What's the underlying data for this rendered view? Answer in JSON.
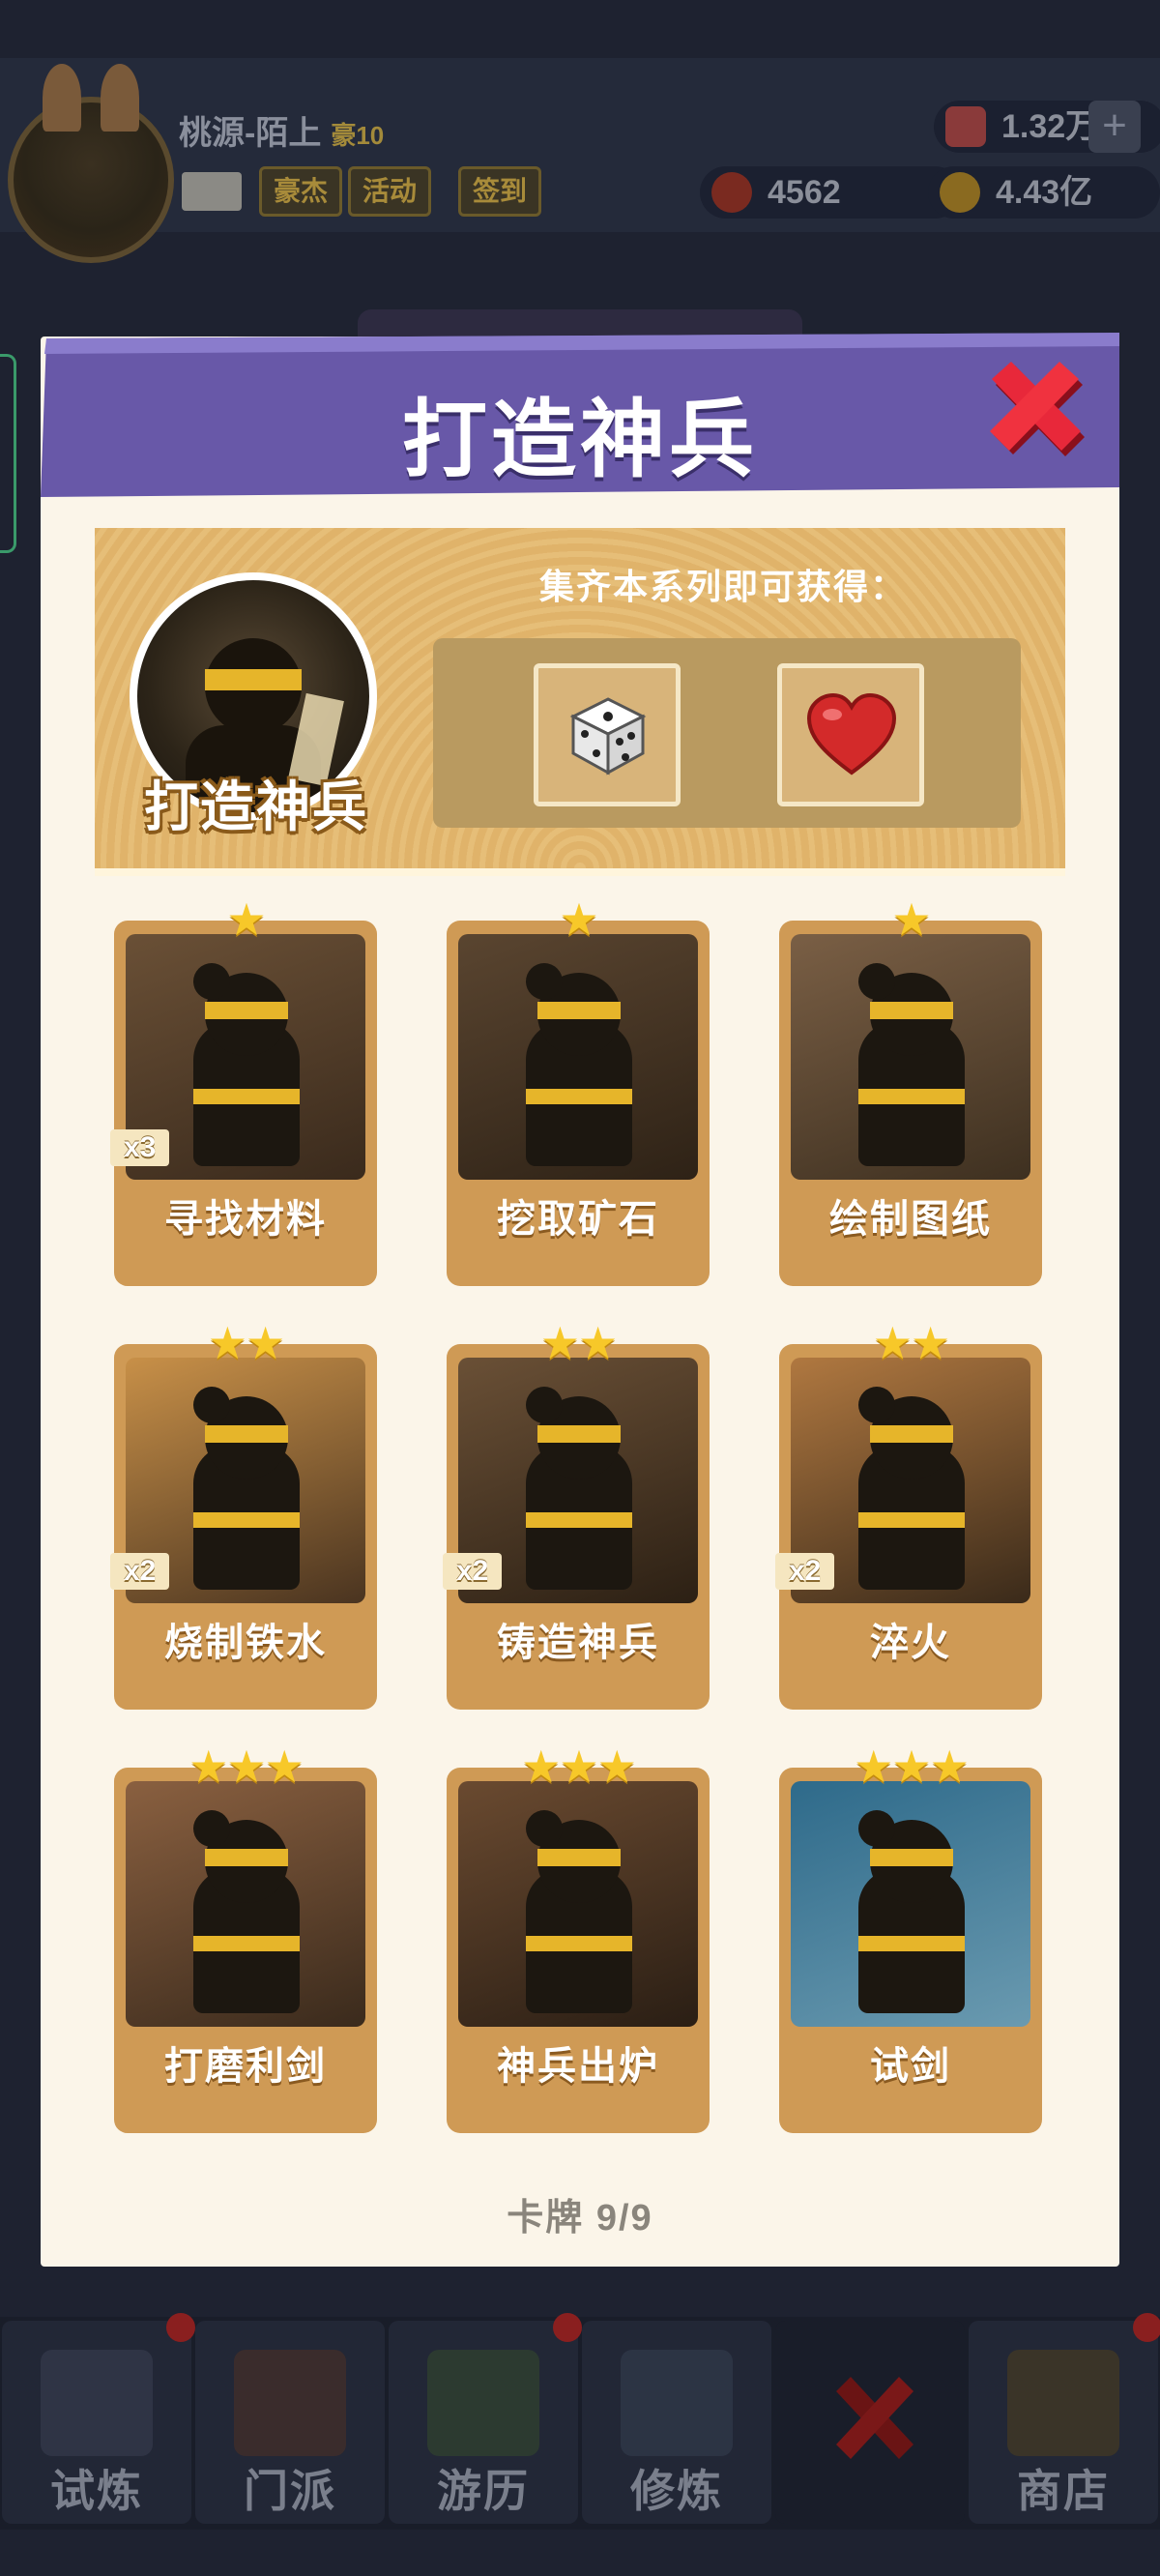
{
  "player": {
    "name": "桃源-陌上",
    "level": "豪10",
    "tags": [
      "豪杰",
      "活动",
      "签到"
    ],
    "gems": "1.32万",
    "tokens": "4562",
    "gold": "4.43亿"
  },
  "modal": {
    "title": "打造神兵",
    "series_name": "打造神兵",
    "reward_title": "集齐本系列即可获得：",
    "rewards": [
      {
        "icon": "dice-icon"
      },
      {
        "icon": "heart-icon"
      }
    ],
    "cards": [
      {
        "name": "寻找材料",
        "stars": "★",
        "multiplier": "x3"
      },
      {
        "name": "挖取矿石",
        "stars": "★",
        "multiplier": ""
      },
      {
        "name": "绘制图纸",
        "stars": "★",
        "multiplier": ""
      },
      {
        "name": "烧制铁水",
        "stars": "★★",
        "multiplier": "x2"
      },
      {
        "name": "铸造神兵",
        "stars": "★★",
        "multiplier": "x2"
      },
      {
        "name": "淬火",
        "stars": "★★",
        "multiplier": "x2"
      },
      {
        "name": "打磨利剑",
        "stars": "★★★",
        "multiplier": ""
      },
      {
        "name": "神兵出炉",
        "stars": "★★★",
        "multiplier": ""
      },
      {
        "name": "试剑",
        "stars": "★★★",
        "multiplier": ""
      }
    ],
    "card_count": "卡牌  9/9"
  },
  "nav": {
    "items": [
      "试炼",
      "门派",
      "游历",
      "修炼",
      "",
      "商店"
    ]
  },
  "colors": {
    "header_purple": "#6a5aa8",
    "close_red": "#d8263a",
    "card_frame": "#cf9a55",
    "star": "#f7c829"
  }
}
